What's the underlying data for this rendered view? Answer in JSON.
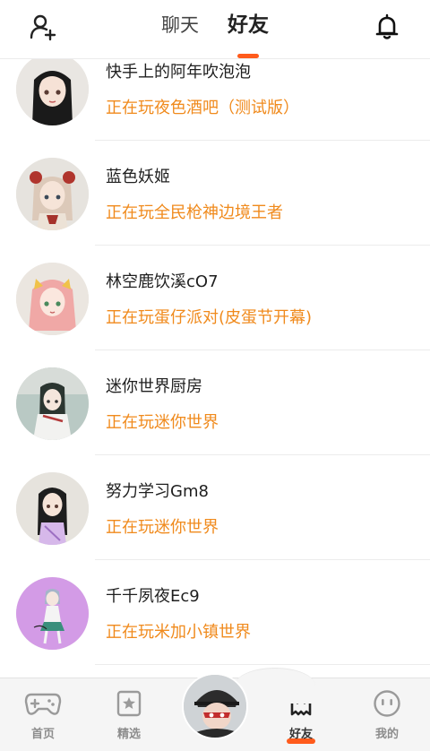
{
  "header": {
    "tabs": [
      {
        "label": "聊天",
        "active": false
      },
      {
        "label": "好友",
        "active": true
      }
    ],
    "left_icon": "add-friend-icon",
    "right_icon": "bell-icon",
    "accent": "#ff5b1c"
  },
  "friends": [
    {
      "name": "快手上的阿年吹泡泡",
      "status": "正在玩夜色酒吧（测试版）"
    },
    {
      "name": "蓝色妖姬",
      "status": "正在玩全民枪神边境王者"
    },
    {
      "name": "林空鹿饮溪cO7",
      "status": "正在玩蛋仔派对(皮蛋节开幕)"
    },
    {
      "name": "迷你世界厨房",
      "status": "正在玩迷你世界"
    },
    {
      "name": "努力学习Gm8",
      "status": "正在玩迷你世界"
    },
    {
      "name": "千千夙夜Ec9",
      "status": "正在玩米加小镇世界"
    }
  ],
  "status_color": "#f08a1c",
  "bottom_nav": [
    {
      "label": "首页",
      "icon": "gamepad-icon",
      "active": false
    },
    {
      "label": "精选",
      "icon": "star-card-icon",
      "active": false
    },
    {
      "label": "好友",
      "icon": "ghost-icon",
      "active": true
    },
    {
      "label": "我的",
      "icon": "face-icon",
      "active": false
    }
  ]
}
